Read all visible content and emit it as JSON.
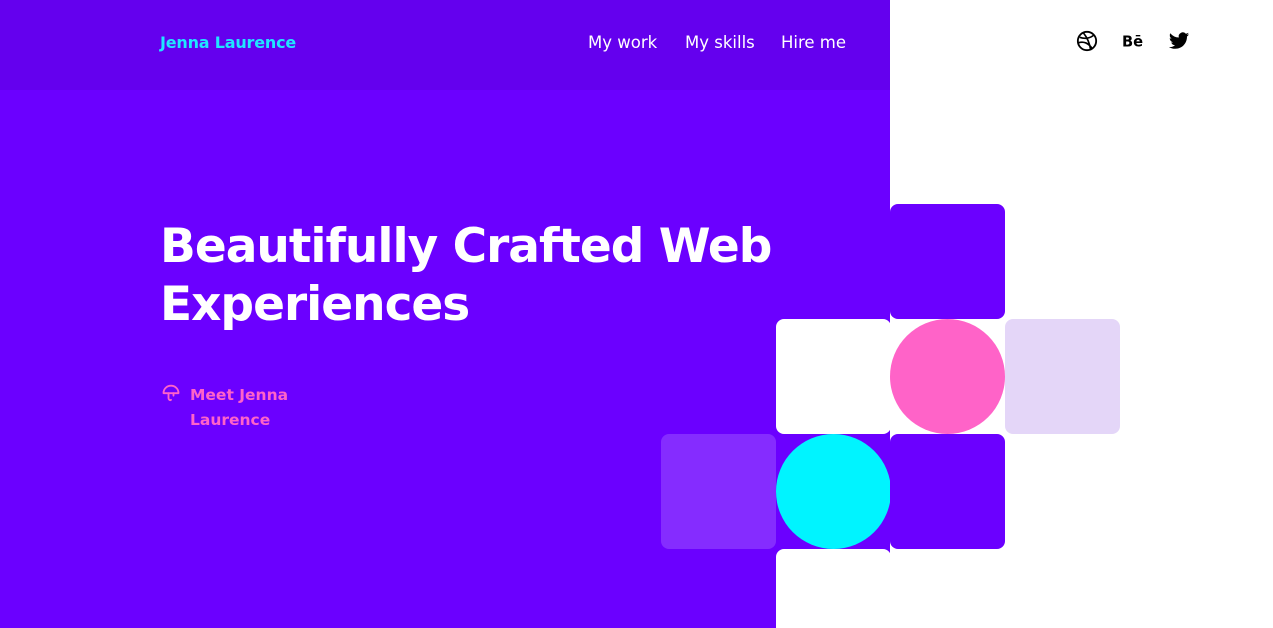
{
  "header": {
    "brand": "Jenna Laurence",
    "nav": [
      "My work",
      "My skills",
      "Hire me"
    ]
  },
  "social": {
    "icons": [
      "dribbble-icon",
      "behance-icon",
      "twitter-icon"
    ],
    "behance_text": "Bē"
  },
  "hero": {
    "title": "Beautifully Crafted Web Experiences",
    "link": "Meet Jenna Laurence",
    "link_icon": "mushroom-icon"
  },
  "colors": {
    "purple": "#6b00ff",
    "header_purple": "#6400ee",
    "cyan": "#00f4ff",
    "brand_cyan": "#1fe6ff",
    "pink": "#ff63c8",
    "lavender": "#e4d6f8",
    "light_purple": "#852cff"
  }
}
